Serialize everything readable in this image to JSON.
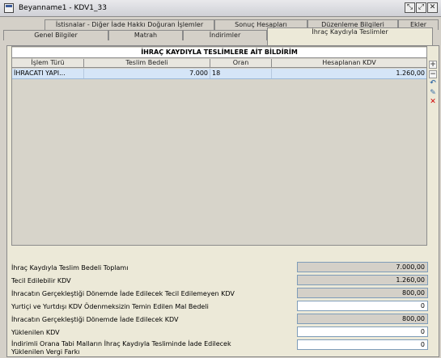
{
  "window": {
    "title": "Beyanname1 - KDV1_33"
  },
  "tabs_row1": [
    {
      "label": "İstisnalar - Diğer İade Hakkı Doğuran İşlemler"
    },
    {
      "label": "Sonuç Hesapları"
    },
    {
      "label": "Düzenleme Bilgileri"
    },
    {
      "label": "Ekler"
    }
  ],
  "tabs_row2": [
    {
      "label": "Genel Bilgiler"
    },
    {
      "label": "Matrah"
    },
    {
      "label": "İndirimler"
    },
    {
      "label": "İhraç Kaydıyla Teslimler"
    }
  ],
  "grid": {
    "title": "İHRAÇ KAYDIYLA TESLİMLERE AİT BİLDİRİM",
    "columns": [
      "İşlem Türü",
      "Teslim Bedeli",
      "Oran",
      "Hesaplanan KDV"
    ],
    "rows": [
      {
        "islem": "İHRACATI YAPI...",
        "bedel": "7.000",
        "oran": "18",
        "kdv": "1.260,00"
      }
    ]
  },
  "side_toolbar": [
    {
      "icon": "add-row-icon"
    },
    {
      "icon": "remove-row-icon"
    },
    {
      "icon": "undo-icon"
    },
    {
      "icon": "edit-icon"
    },
    {
      "icon": "delete-icon"
    }
  ],
  "summary": [
    {
      "label": "İhraç Kaydıyla Teslim Bedeli Toplamı",
      "value": "7.000,00",
      "editable": false
    },
    {
      "label": "Tecil Edilebilir KDV",
      "value": "1.260,00",
      "editable": false
    },
    {
      "label": "İhracatın Gerçekleştiği Dönemde İade Edilecek Tecil Edilemeyen KDV",
      "value": "800,00",
      "editable": false
    },
    {
      "label": "Yurtiçi ve Yurtdışı KDV Ödenmeksizin Temin Edilen Mal Bedeli",
      "value": "0",
      "editable": true
    },
    {
      "label": "İhracatın Gerçekleştiği Dönemde İade Edilecek KDV",
      "value": "800,00",
      "editable": false
    },
    {
      "label": "Yüklenilen KDV",
      "value": "0",
      "editable": true
    },
    {
      "label": "İndirimli Orana Tabi Malların İhraç Kaydıyla Tesliminde İade Edilecek",
      "label2": "Yüklenilen Vergi Farkı",
      "value": "0",
      "editable": true
    }
  ]
}
